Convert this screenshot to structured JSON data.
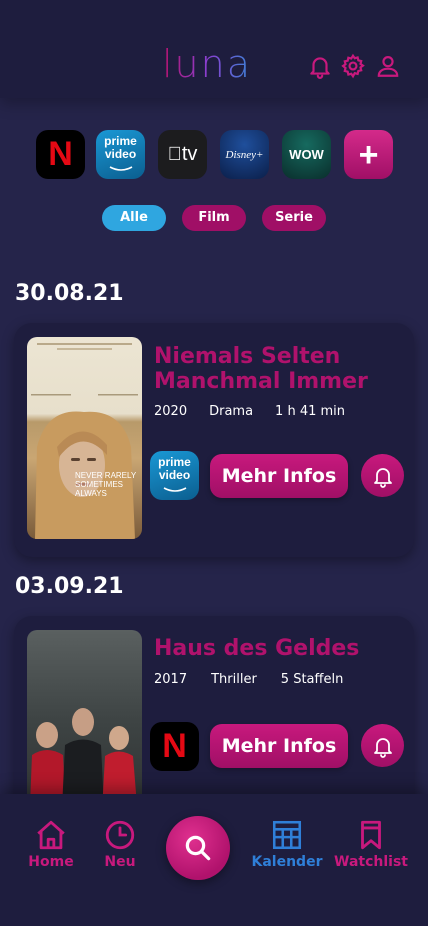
{
  "app": {
    "logo": "luna"
  },
  "header": {
    "icons": [
      "bell-icon",
      "gear-icon",
      "user-icon"
    ]
  },
  "providers": [
    {
      "name": "netflix",
      "label": "N",
      "bg": "#000000"
    },
    {
      "name": "prime-video",
      "label1": "prime",
      "label2": "video",
      "bg": "#0f79af"
    },
    {
      "name": "apple-tv",
      "label": "tv",
      "bg": "#1c1c1e"
    },
    {
      "name": "disney-plus",
      "label": "Disney+",
      "bg": "#0e2d63"
    },
    {
      "name": "wow",
      "label": "WOW",
      "bg": "#0d3d3a"
    },
    {
      "name": "add",
      "label": "+",
      "bg": "#c8197d"
    }
  ],
  "filters": {
    "all": "Alle",
    "film": "Film",
    "series": "Serie",
    "active": "Alle"
  },
  "entries": [
    {
      "date": "30.08.21",
      "title_line1": "Niemals Selten",
      "title_line2": "Manchmal Immer",
      "year": "2020",
      "genre": "Drama",
      "duration": "1 h 41 min",
      "service": "prime-video",
      "service_label1": "prime",
      "service_label2": "video",
      "more_label": "Mehr Infos",
      "poster_text": "NEVER RARELY SOMETIMES ALWAYS"
    },
    {
      "date": "03.09.21",
      "title_line1": "Haus des Geldes",
      "year": "2017",
      "genre": "Thriller",
      "duration": "5 Staffeln",
      "service": "netflix",
      "service_label": "N",
      "more_label": "Mehr Infos"
    }
  ],
  "nav": {
    "home": "Home",
    "new": "Neu",
    "calendar": "Kalender",
    "watchlist": "Watchlist",
    "active": "Kalender"
  },
  "colors": {
    "accent": "#b0126c",
    "active_blue": "#2f7fd8",
    "chip_blue": "#2fa6e0",
    "background": "#25244a",
    "card": "#1e1d3e"
  }
}
